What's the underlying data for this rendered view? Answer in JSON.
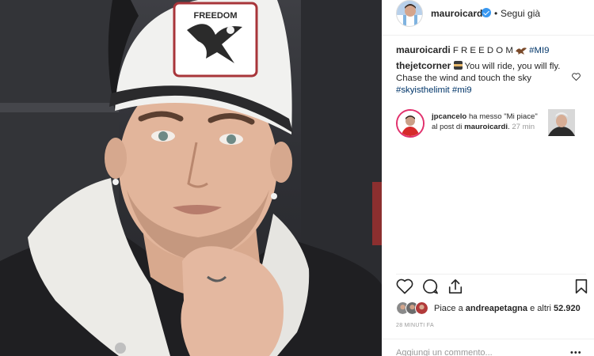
{
  "post": {
    "username": "mauroicardi",
    "follow_label": "Segui già",
    "header_dot": "•",
    "caption_text": "F R E E D O M",
    "caption_tag": "#MI9",
    "cap_text": "FREEDOM"
  },
  "comment": {
    "username": "thejetcorner",
    "text_1": "You will ride, you will fly.",
    "text_2": "Chase the wind and touch the sky",
    "tags": "#skyisthelimit #mi9"
  },
  "notification": {
    "username": "jpcancelo",
    "text_1": "ha messo \"Mi piace\"",
    "text_2": "al post di",
    "target_user": "mauroicardi",
    "time": "27 min"
  },
  "likes": {
    "prefix": "Piace a",
    "user": "andreapetagna",
    "middle": "e altri",
    "count": "52.920"
  },
  "timestamp": "28 MINUTI FA",
  "add_comment_placeholder": "Aggiungi un commento...",
  "more_label": "•••",
  "colors": {
    "link": "#003569",
    "verified": "#3897f0",
    "muted": "#999999",
    "story_ring": "#e1306c"
  },
  "icons": [
    "verified-badge-icon",
    "heart-icon",
    "comment-icon",
    "share-icon",
    "bookmark-icon",
    "eagle-emoji-icon",
    "ninja-emoji-icon"
  ]
}
